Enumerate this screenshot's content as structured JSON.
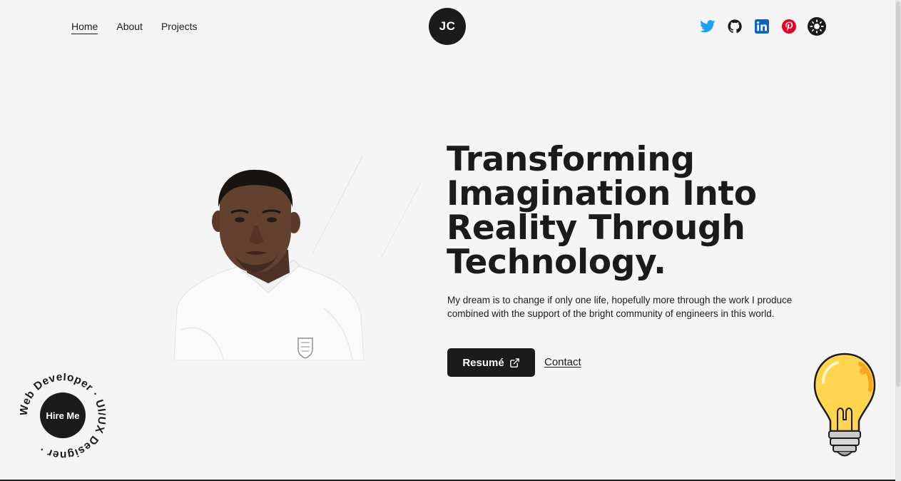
{
  "header": {
    "nav": [
      {
        "label": "Home",
        "active": true
      },
      {
        "label": "About",
        "active": false
      },
      {
        "label": "Projects",
        "active": false
      }
    ],
    "logo": "JC",
    "social": [
      {
        "icon": "twitter-icon",
        "color": "#1DA1F2"
      },
      {
        "icon": "github-icon",
        "color": "#1b1b1b"
      },
      {
        "icon": "linkedin-icon",
        "color": "#0A66C2"
      },
      {
        "icon": "pinterest-icon",
        "color": "#E60023"
      },
      {
        "icon": "sun-icon",
        "color": "#1b1b1b"
      }
    ]
  },
  "hero": {
    "headline": "Transforming Imagination Into Reality Through Technology.",
    "intro": "My dream is to change if only one life, hopefully more through the work I produce combined with the support of the bright community of engineers in this world.",
    "resume_label": "Resumé",
    "contact_label": "Contact"
  },
  "badge": {
    "hire_label": "Hire Me",
    "ring_text": "Web Developer · UI/UX Designer ·"
  },
  "colors": {
    "background": "#f5f5f5",
    "dark": "#1b1b1b",
    "bulb": "#FFD54F"
  }
}
